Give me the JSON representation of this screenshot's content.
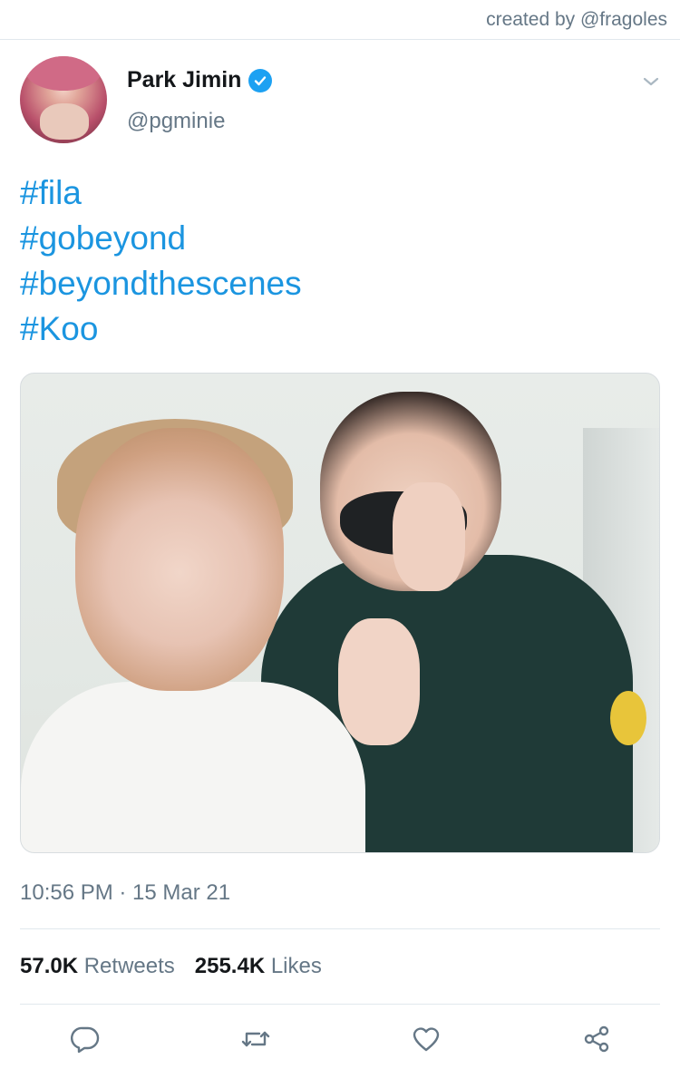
{
  "credit": "created by @fragoles",
  "author": {
    "name": "Park Jimin",
    "handle": "@pgminie",
    "verified": true,
    "avatar_icon": "profile-photo"
  },
  "tweet": {
    "hashtags": [
      "#fila",
      "#gobeyond",
      "#beyondthescenes",
      "#Koo"
    ],
    "timestamp": "10:56 PM · 15 Mar 21"
  },
  "stats": {
    "retweets_count": "57.0K",
    "retweets_label": "Retweets",
    "likes_count": "255.4K",
    "likes_label": "Likes"
  },
  "actions": [
    {
      "name": "reply",
      "icon": "reply-icon"
    },
    {
      "name": "retweet",
      "icon": "retweet-icon"
    },
    {
      "name": "like",
      "icon": "heart-icon"
    },
    {
      "name": "share",
      "icon": "share-icon"
    }
  ],
  "colors": {
    "link": "#1b95e0",
    "verified": "#1da1f2",
    "secondary_text": "#657786",
    "divider": "#e1e8ed"
  }
}
